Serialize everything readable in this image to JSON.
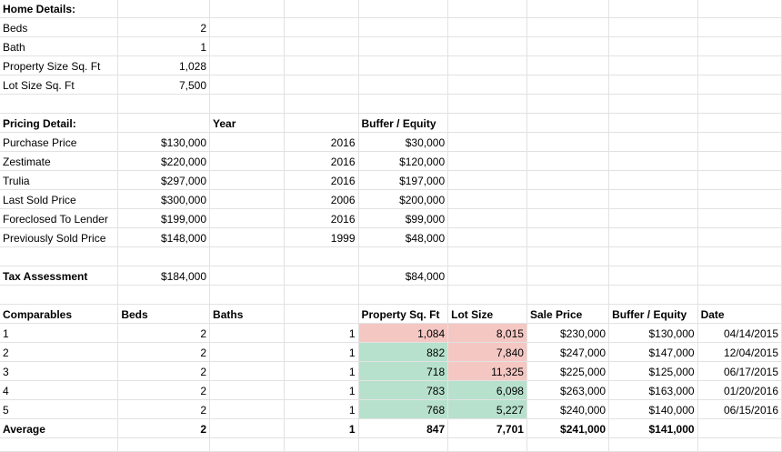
{
  "rows": [
    [
      "Home Details:",
      "",
      "",
      "",
      "",
      "",
      "",
      "",
      ""
    ],
    [
      "Beds",
      "2",
      "",
      "",
      "",
      "",
      "",
      "",
      ""
    ],
    [
      "Bath",
      "1",
      "",
      "",
      "",
      "",
      "",
      "",
      ""
    ],
    [
      "Property Size Sq. Ft",
      "1,028",
      "",
      "",
      "",
      "",
      "",
      "",
      ""
    ],
    [
      "Lot Size Sq. Ft",
      "7,500",
      "",
      "",
      "",
      "",
      "",
      "",
      ""
    ],
    [
      "",
      "",
      "",
      "",
      "",
      "",
      "",
      "",
      ""
    ],
    [
      "Pricing Detail:",
      "",
      "Year",
      "",
      "Buffer / Equity",
      "",
      "",
      "",
      ""
    ],
    [
      "Purchase Price",
      "$130,000",
      "",
      "2016",
      "$30,000",
      "",
      "",
      "",
      ""
    ],
    [
      "Zestimate",
      "$220,000",
      "",
      "2016",
      "$120,000",
      "",
      "",
      "",
      ""
    ],
    [
      "Trulia",
      "$297,000",
      "",
      "2016",
      "$197,000",
      "",
      "",
      "",
      ""
    ],
    [
      "Last Sold Price",
      "$300,000",
      "",
      "2006",
      "$200,000",
      "",
      "",
      "",
      ""
    ],
    [
      "Foreclosed To Lender",
      "$199,000",
      "",
      "2016",
      "$99,000",
      "",
      "",
      "",
      ""
    ],
    [
      "Previously Sold Price",
      "$148,000",
      "",
      "1999",
      "$48,000",
      "",
      "",
      "",
      ""
    ],
    [
      "",
      "",
      "",
      "",
      "",
      "",
      "",
      "",
      ""
    ],
    [
      "Tax Assessment",
      "$184,000",
      "",
      "",
      "$84,000",
      "",
      "",
      "",
      ""
    ],
    [
      "",
      "",
      "",
      "",
      "",
      "",
      "",
      "",
      ""
    ],
    [
      "Comparables",
      "Beds",
      "Baths",
      "",
      "Property Sq. Ft",
      "Lot Size",
      "Sale Price",
      "Buffer / Equity",
      "Date"
    ],
    [
      "1",
      "2",
      "",
      "1",
      "1,084",
      "8,015",
      "$230,000",
      "$130,000",
      "04/14/2015"
    ],
    [
      "2",
      "2",
      "",
      "1",
      "882",
      "7,840",
      "$247,000",
      "$147,000",
      "12/04/2015"
    ],
    [
      "3",
      "2",
      "",
      "1",
      "718",
      "11,325",
      "$225,000",
      "$125,000",
      "06/17/2015"
    ],
    [
      "4",
      "2",
      "",
      "1",
      "783",
      "6,098",
      "$263,000",
      "$163,000",
      "01/20/2016"
    ],
    [
      "5",
      "2",
      "",
      "1",
      "768",
      "5,227",
      "$240,000",
      "$140,000",
      "06/15/2016"
    ],
    [
      "Average",
      "2",
      "",
      "1",
      "847",
      "7,701",
      "$241,000",
      "$141,000",
      ""
    ],
    [
      "",
      "",
      "",
      "",
      "",
      "",
      "",
      "",
      ""
    ]
  ],
  "colors": {
    "highlight_red": "#f4c7c3",
    "highlight_green": "#b7e1cd",
    "gridline": "#e2e2e2"
  }
}
